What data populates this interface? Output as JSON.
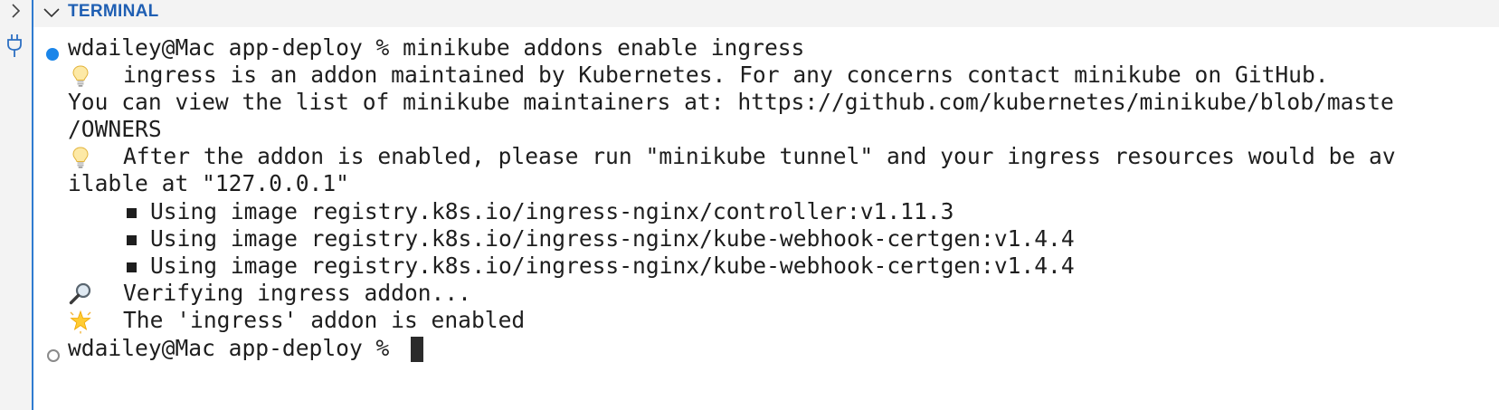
{
  "panel": {
    "title": "TERMINAL"
  },
  "icons": {
    "sidebar_toggle": "chevron-right-icon",
    "collapse": "chevron-down-icon",
    "port_forward": "plug-icon",
    "tip": "lightbulb-icon",
    "verify": "magnifying-glass-icon",
    "success": "glowing-star-icon",
    "command_success": "filled-circle",
    "prompt_idle": "hollow-circle"
  },
  "colors": {
    "accent": "#1f5fb3",
    "success_dot": "#1a85e9",
    "panel_bg": "#f3f3f3",
    "terminal_bg": "#ffffff",
    "text": "#1e1e1e"
  },
  "terminal": {
    "command_prompt": "wdailey@Mac app-deploy % minikube addons enable ingress",
    "tip1_line1": "ingress is an addon maintained by Kubernetes. For any concerns contact minikube on GitHub.",
    "tip1_line2": "You can view the list of minikube maintainers at: https://github.com/kubernetes/minikube/blob/maste",
    "tip1_line3": "/OWNERS",
    "tip2_line1": "After the addon is enabled, please run \"minikube tunnel\" and your ingress resources would be av",
    "tip2_line2": "ilable at \"127.0.0.1\"",
    "image1": "Using image registry.k8s.io/ingress-nginx/controller:v1.11.3",
    "image2": "Using image registry.k8s.io/ingress-nginx/kube-webhook-certgen:v1.4.4",
    "image3": "Using image registry.k8s.io/ingress-nginx/kube-webhook-certgen:v1.4.4",
    "verifying": "Verifying ingress addon...",
    "enabled": "The 'ingress' addon is enabled",
    "final_prompt": "wdailey@Mac app-deploy % "
  }
}
